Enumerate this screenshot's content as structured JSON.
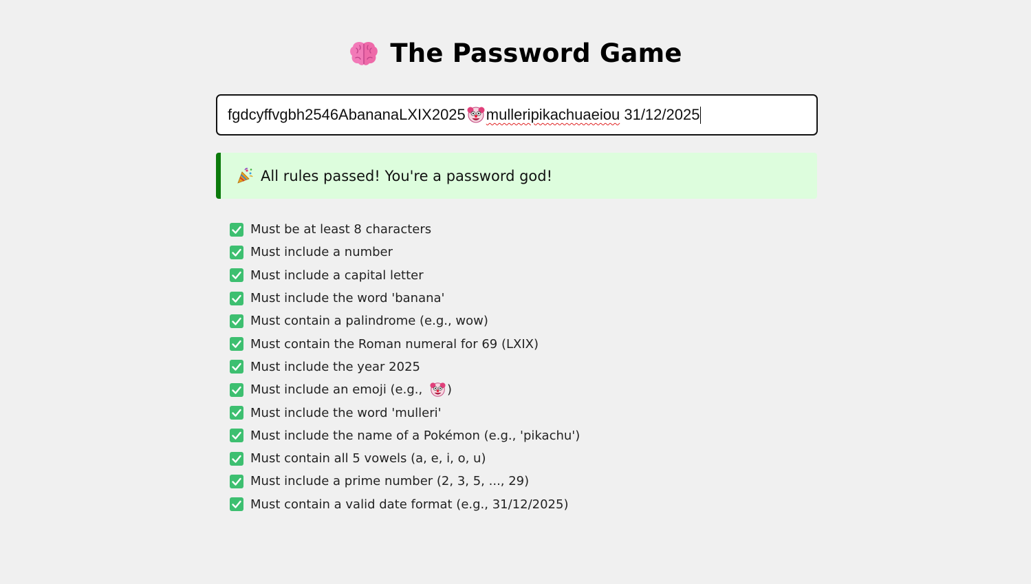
{
  "app": {
    "title": "The Password Game",
    "title_icon": "brain-icon"
  },
  "password": {
    "part_before_emoji": "fgdcyffvgbh2546AbananaLXIX2025",
    "emoji_icon": "clown-face-icon",
    "misspelled_word": "mulleripikachuaeiou",
    "part_after": " 31/12/2025"
  },
  "status": {
    "icon": "party-popper-icon",
    "message": "All rules passed! You're a password god!",
    "accent_color": "#0b7a0b",
    "background_color": "#ddfddd"
  },
  "rules": [
    {
      "text": "Must be at least 8 characters",
      "passed": true
    },
    {
      "text": "Must include a number",
      "passed": true
    },
    {
      "text": "Must include a capital letter",
      "passed": true
    },
    {
      "text": "Must include the word 'banana'",
      "passed": true
    },
    {
      "text": "Must contain a palindrome (e.g., wow)",
      "passed": true
    },
    {
      "text": "Must contain the Roman numeral for 69 (LXIX)",
      "passed": true
    },
    {
      "text": "Must include the year 2025",
      "passed": true
    },
    {
      "text_before": "Must include an emoji (e.g., ",
      "text_after": ")",
      "emoji_icon": "clown-face-icon",
      "passed": true
    },
    {
      "text": "Must include the word 'mulleri'",
      "passed": true
    },
    {
      "text": "Must include the name of a Pokémon (e.g., 'pikachu')",
      "passed": true
    },
    {
      "text": "Must contain all 5 vowels (a, e, i, o, u)",
      "passed": true
    },
    {
      "text": "Must include a prime number (2, 3, 5, ..., 29)",
      "passed": true
    },
    {
      "text": "Must contain a valid date format (e.g., 31/12/2025)",
      "passed": true
    }
  ],
  "colors": {
    "check_green": "#3dbf70",
    "page_background": "#f0f0f0"
  }
}
